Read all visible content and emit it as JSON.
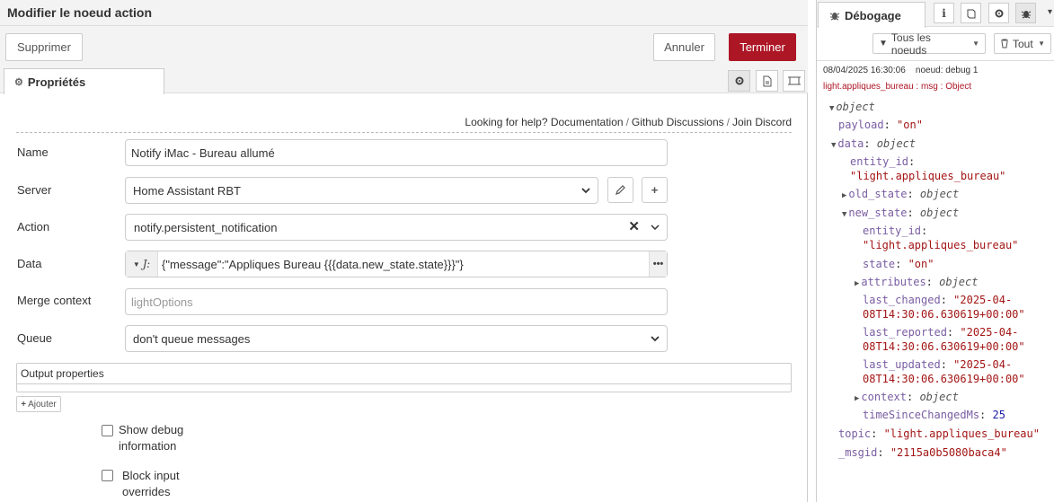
{
  "editor": {
    "title": "Modifier le noeud action",
    "delete_label": "Supprimer",
    "cancel_label": "Annuler",
    "done_label": "Terminer",
    "tab_label": "Propriétés",
    "help": {
      "prefix": "Looking for help?",
      "links": [
        "Documentation",
        "Github Discussions",
        "Join Discord"
      ]
    },
    "fields": {
      "name": {
        "label": "Name",
        "value": "Notify iMac - Bureau allumé"
      },
      "server": {
        "label": "Server",
        "value": "Home Assistant RBT"
      },
      "action": {
        "label": "Action",
        "value": "notify.persistent_notification"
      },
      "data": {
        "label": "Data",
        "value": "{\"message\":\"Appliques Bureau {{{data.new_state.state}}}\"}",
        "type_prefix": "J:"
      },
      "merge_context": {
        "label": "Merge context",
        "placeholder": "lightOptions"
      },
      "queue": {
        "label": "Queue",
        "value": "don't queue messages"
      }
    },
    "output": {
      "title": "Output properties",
      "add_label": "Ajouter"
    },
    "checkboxes": [
      {
        "line1": "Show debug",
        "line2": "information",
        "checked": false
      },
      {
        "line1": "Block input",
        "line2": "overrides",
        "checked": false
      }
    ]
  },
  "debug": {
    "tab_label": "Débogage",
    "filter_nodes": "Tous les noeuds",
    "filter_all": "Tout",
    "msg_timestamp": "08/04/2025 16:30:06",
    "msg_node": "noeud: debug 1",
    "msg_topic": "light.appliques_bureau : msg : Object",
    "tree": {
      "root": "object",
      "payload_key": "payload",
      "payload_val": "\"on\"",
      "data_key": "data",
      "type_object": "object",
      "entity_id_key": "entity_id",
      "entity_id_val": "\"light.appliques_bureau\"",
      "old_state_key": "old_state",
      "new_state_key": "new_state",
      "state_key": "state",
      "state_val": "\"on\"",
      "attributes_key": "attributes",
      "last_changed_key": "last_changed",
      "last_changed_val1": "\"2025-04-",
      "last_changed_val2": "08T14:30:06.630619+00:00\"",
      "last_reported_key": "last_reported",
      "last_reported_val1": "\"2025-04-",
      "last_reported_val2": "08T14:30:06.630619+00:00\"",
      "last_updated_key": "last_updated",
      "last_updated_val1": "\"2025-04-",
      "last_updated_val2": "08T14:30:06.630619+00:00\"",
      "context_key": "context",
      "since_key": "timeSinceChangedMs",
      "since_val": "25",
      "topic_key": "topic",
      "topic_val": "\"light.appliques_bureau\"",
      "msgid_key": "_msgid",
      "msgid_val": "\"2115a0b5080baca4\""
    }
  }
}
